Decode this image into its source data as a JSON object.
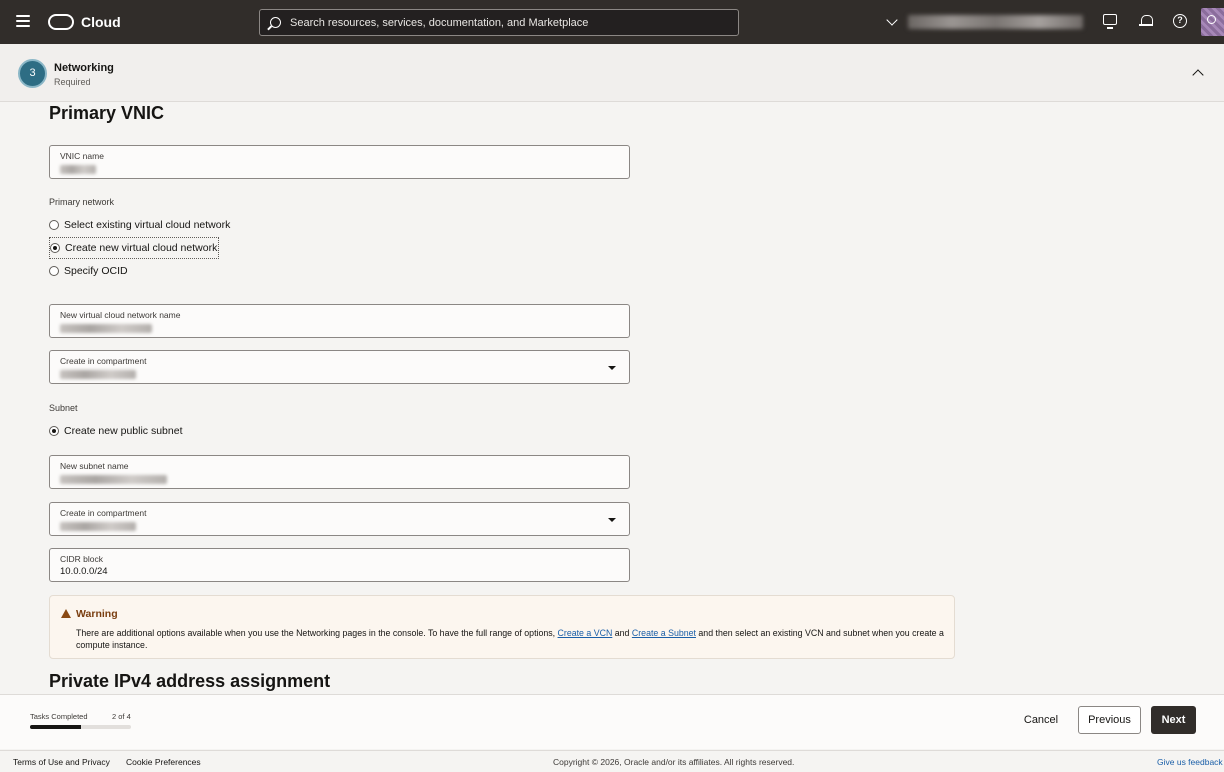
{
  "header": {
    "brand": "Cloud",
    "search": {
      "placeholder": "Search resources, services, documentation, and Marketplace"
    },
    "help_glyph": "?"
  },
  "step": {
    "number": "3",
    "title": "Networking",
    "subtitle": "Required"
  },
  "primary_vnic": {
    "heading": "Primary VNIC",
    "vnic_name_label": "VNIC name",
    "primary_network_label": "Primary network",
    "options": [
      {
        "label": "Select existing virtual cloud network",
        "selected": false
      },
      {
        "label": "Create new virtual cloud network",
        "selected": true
      },
      {
        "label": "Specify OCID",
        "selected": false
      }
    ],
    "new_vcn_name_label": "New virtual cloud network name",
    "vcn_compartment_label": "Create in compartment",
    "subnet_label": "Subnet",
    "subnet_option": "Create new public subnet",
    "new_subnet_name_label": "New subnet name",
    "subnet_compartment_label": "Create in compartment",
    "cidr_label": "CIDR block",
    "cidr_value": "10.0.0.0/24"
  },
  "warning": {
    "title": "Warning",
    "text_before": "There are additional options available when you use the Networking pages in the console. To have the full range of options, ",
    "link_vcn": "Create a VCN",
    "text_and": " and ",
    "link_subnet": "Create a Subnet",
    "text_after": " and then select an existing VCN and subnet when you create a compute instance."
  },
  "private_ipv4": {
    "heading": "Private IPv4 address assignment"
  },
  "footer": {
    "tasks_label": "Tasks Completed",
    "tasks_count": "2 of 4",
    "progress_fraction": 0.5,
    "cancel": "Cancel",
    "previous": "Previous",
    "next": "Next"
  },
  "legal": {
    "terms": "Terms of Use and Privacy",
    "cookies": "Cookie Preferences",
    "copyright": "Copyright © 2026, Oracle and/or its affiliates. All rights reserved.",
    "feedback": "Give us feedback"
  },
  "colors": {
    "topbar": "#312d2a",
    "step_circle": "#2e6d84",
    "warning_title": "#7a3e10",
    "link": "#1a5fa8",
    "primary_button": "#312d2a"
  }
}
